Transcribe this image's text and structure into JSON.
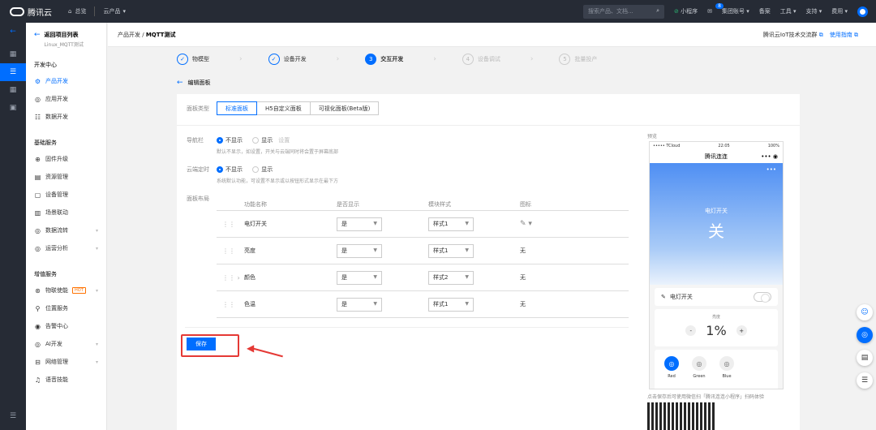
{
  "topbar": {
    "brand": "腾讯云",
    "overview": "总览",
    "products": "云产品",
    "search_placeholder": "搜索产品、文档...",
    "mini": "小程序",
    "msg_count": "8",
    "group": "集团账号",
    "record": "备案",
    "tools": "工具",
    "support": "支持",
    "cost": "费用"
  },
  "sidebar": {
    "back_title": "返回项目列表",
    "back_sub": "Linux_MQTT测试",
    "sec1": "开发中心",
    "sec2": "基础服务",
    "sec3": "增值服务",
    "dev": [
      "产品开发",
      "应用开发",
      "数据开发"
    ],
    "base": [
      "固件升级",
      "资源管理",
      "设备管理",
      "场景联动",
      "数据流转",
      "运营分析"
    ],
    "plus": [
      "物联使能",
      "位置服务",
      "告警中心",
      "AI开发",
      "网络管理",
      "语音技能"
    ],
    "hot": "HOT"
  },
  "header": {
    "crumb_parent": "产品开发",
    "crumb_sep": "/",
    "crumb_current": "MQTT测试",
    "link1": "腾讯云IoT技术交流群",
    "link2": "使用指南"
  },
  "steps": [
    {
      "n": "✓",
      "label": "物模型"
    },
    {
      "n": "✓",
      "label": "设备开发"
    },
    {
      "n": "3",
      "label": "交互开发"
    },
    {
      "n": "4",
      "label": "设备调试"
    },
    {
      "n": "5",
      "label": "批量投产"
    }
  ],
  "edit": {
    "back_label": "编辑面板"
  },
  "panel": {
    "type_label": "面板类型",
    "tabs": [
      "标准面板",
      "H5自定义面板",
      "可视化面板(Beta版)"
    ],
    "nav_label": "导航栏",
    "nav_opt1": "不显示",
    "nav_opt2": "显示",
    "nav_opt2_sub": "设置",
    "nav_tip": "默认不显示，如设置，开关与云端同时将会置于屏幕底部",
    "timer_label": "云端定时",
    "timer_opt1": "不显示",
    "timer_opt2": "显示",
    "timer_tip": "系统默认功能，可设置不显示或以按钮形式显示在最下方",
    "layout_label": "面板布局",
    "cols": [
      "功能名称",
      "是否显示",
      "模块样式",
      "图标"
    ],
    "rows": [
      {
        "name": "电灯开关",
        "show": "是",
        "style": "样式1",
        "icon": "✎ ▾"
      },
      {
        "name": "亮度",
        "show": "是",
        "style": "样式1",
        "icon": "无"
      },
      {
        "name": "颜色",
        "show": "是",
        "style": "样式2",
        "icon": "无"
      },
      {
        "name": "色温",
        "show": "是",
        "style": "样式1",
        "icon": "无"
      }
    ],
    "save": "保存"
  },
  "preview": {
    "label": "预览",
    "carrier": "••••• TCloud",
    "time": "22:05",
    "battery": "100%",
    "app": "腾讯连连",
    "hero_title": "电灯开关",
    "hero_state": "关",
    "switch_label": "电灯开关",
    "bright_label": "亮度",
    "bright_val": "1%",
    "colors": [
      "Red",
      "Green",
      "Blue"
    ],
    "tip": "点击保存后可使用微信扫「腾讯连连小程序」扫码体验"
  }
}
